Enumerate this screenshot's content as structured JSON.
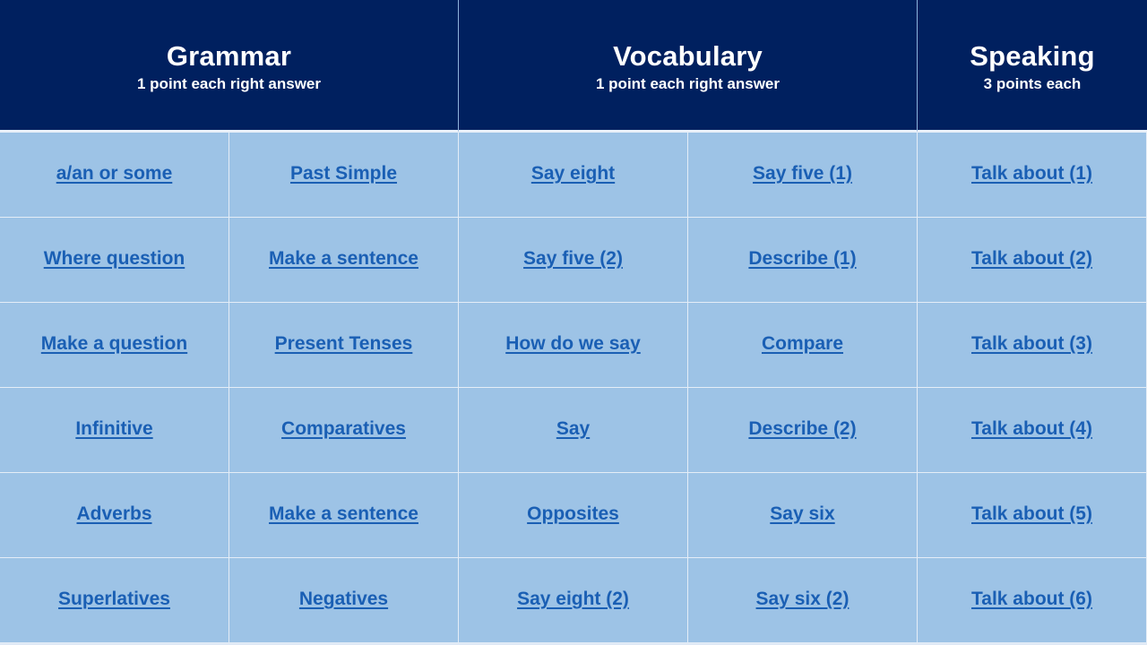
{
  "headers": [
    {
      "title": "Grammar",
      "subtitle": "1 point each right answer"
    },
    {
      "title": "Vocabulary",
      "subtitle": "1 point each right answer"
    },
    {
      "title": "Speaking",
      "subtitle": "3 points each"
    }
  ],
  "colors": {
    "header_bg": "#00205f",
    "cell_bg": "#9dc3e6",
    "link": "#1a5fb4"
  },
  "rows": [
    [
      "a/an or some",
      "Past Simple",
      "Say eight",
      "Say five (1)",
      "Talk about (1)"
    ],
    [
      "Where question",
      "Make a sentence",
      "Say five (2)",
      "Describe (1)",
      "Talk about (2)"
    ],
    [
      "Make a question",
      "Present Tenses",
      "How do we say",
      "Compare",
      "Talk about (3)"
    ],
    [
      "Infinitive",
      "Comparatives",
      "Say",
      "Describe (2)",
      "Talk about (4)"
    ],
    [
      "Adverbs",
      "Make a sentence",
      "Opposites",
      "Say six",
      "Talk about (5)"
    ],
    [
      "Superlatives",
      "Negatives",
      "Say eight (2)",
      "Say six (2)",
      "Talk about (6)"
    ]
  ]
}
